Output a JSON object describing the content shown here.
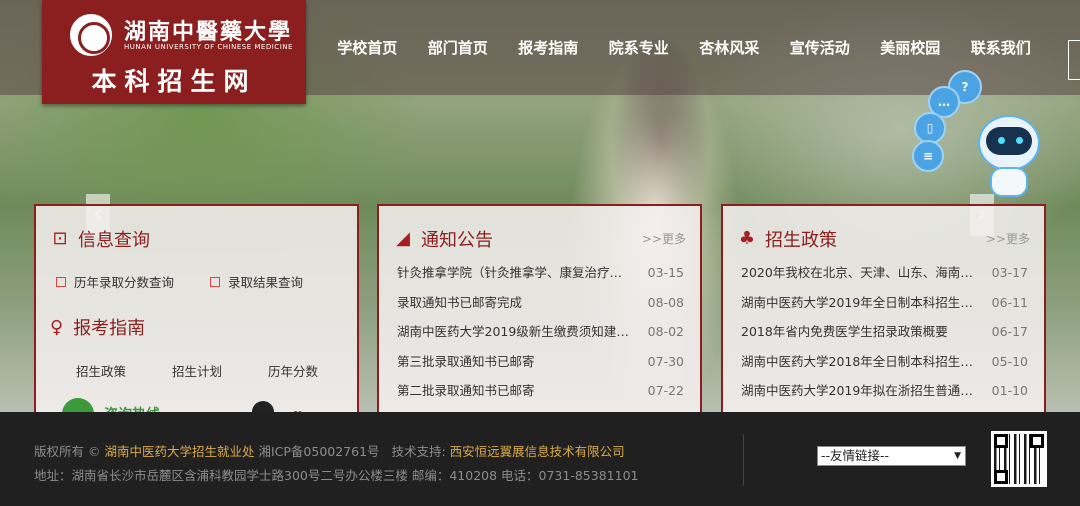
{
  "header": {
    "logo_cn": "湖南中醫藥大學",
    "logo_en": "HUNAN UNIVERSITY OF CHINESE MEDICINE",
    "logo_sub": "本科招生网",
    "nav": [
      "学校首页",
      "部门首页",
      "报考指南",
      "院系专业",
      "杏林风采",
      "宣传活动",
      "美丽校园",
      "联系我们"
    ]
  },
  "panel_query": {
    "title": "信息查询",
    "links": [
      "历年录取分数查询",
      "录取结果查询"
    ],
    "guide_title": "报考指南",
    "guide_links": [
      "招生政策",
      "招生计划",
      "历年分数"
    ],
    "hotline": "咨询热线"
  },
  "panel_notice": {
    "title": "通知公告",
    "more": ">>更多",
    "items": [
      {
        "title": "针灸推拿学院（针灸推拿学、康复治疗学...",
        "date": "03-15"
      },
      {
        "title": "录取通知书已邮寄完成",
        "date": "08-08"
      },
      {
        "title": "湖南中医药大学2019级新生缴费须知建设...",
        "date": "08-02"
      },
      {
        "title": "第三批录取通知书已邮寄",
        "date": "07-30"
      },
      {
        "title": "第二批录取通知书已邮寄",
        "date": "07-22"
      }
    ]
  },
  "panel_policy": {
    "title": "招生政策",
    "more": ">>更多",
    "items": [
      {
        "title": "2020年我校在北京、天津、山东、海南四...",
        "date": "03-17"
      },
      {
        "title": "湖南中医药大学2019年全日制本科招生章...",
        "date": "06-11"
      },
      {
        "title": "2018年省内免费医学生招录政策概要",
        "date": "06-17"
      },
      {
        "title": "湖南中医药大学2018年全日制本科招生章...",
        "date": "05-10"
      },
      {
        "title": "湖南中医药大学2019年拟在浙招生普通高...",
        "date": "01-10"
      }
    ]
  },
  "footer": {
    "copyright_prefix": "版权所有 ©",
    "owner": "湖南中医药大学招生就业处",
    "icp": "湘ICP备05002761号",
    "support_label": "技术支持:",
    "support": "西安恒远翼展信息技术有限公司",
    "address": "地址：湖南省长沙市岳麓区含浦科教园学士路300号二号办公楼三楼 邮编：410208 电话：0731-85381101",
    "friend_links": "--友情链接--"
  },
  "colors": {
    "brand": "#8b1e1e",
    "footer_bg": "#202020",
    "highlight": "#d9a94a"
  }
}
